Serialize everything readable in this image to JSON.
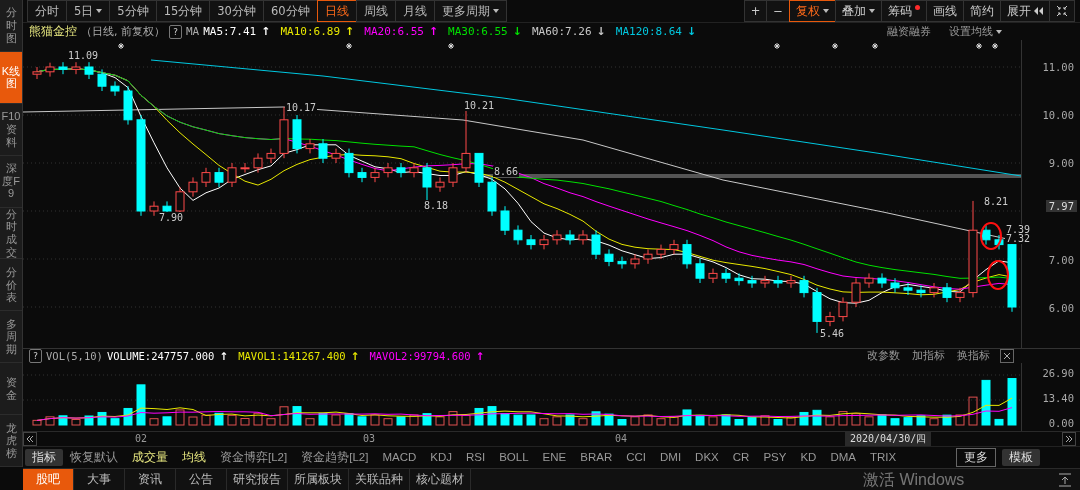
{
  "sidebar": {
    "items": [
      {
        "label": "分时图",
        "selected": false
      },
      {
        "label": "K线图",
        "selected": true
      },
      {
        "label": "F10资料",
        "selected": false
      },
      {
        "label": "深度F9",
        "selected": false
      },
      {
        "label": "分时成交",
        "selected": false
      },
      {
        "label": "分价表",
        "selected": false
      },
      {
        "label": "多周期",
        "selected": false
      },
      {
        "label": "资金",
        "selected": false
      },
      {
        "label": "龙虎榜",
        "selected": false
      }
    ]
  },
  "period_tabs": [
    {
      "label": "分时",
      "selected": false,
      "dropdown": false
    },
    {
      "label": "5日",
      "selected": false,
      "dropdown": true
    },
    {
      "label": "5分钟",
      "selected": false,
      "dropdown": false
    },
    {
      "label": "15分钟",
      "selected": false,
      "dropdown": false
    },
    {
      "label": "30分钟",
      "selected": false,
      "dropdown": false
    },
    {
      "label": "60分钟",
      "selected": false,
      "dropdown": false
    },
    {
      "label": "日线",
      "selected": true,
      "dropdown": false
    },
    {
      "label": "周线",
      "selected": false,
      "dropdown": false
    },
    {
      "label": "月线",
      "selected": false,
      "dropdown": false
    },
    {
      "label": "更多周期",
      "selected": false,
      "dropdown": true
    }
  ],
  "toolbar_buttons": [
    {
      "kind": "text",
      "label": "+",
      "selected": false
    },
    {
      "kind": "text",
      "label": "−",
      "selected": false
    },
    {
      "kind": "dropdown",
      "label": "复权",
      "selected": true
    },
    {
      "kind": "dropdown",
      "label": "叠加",
      "selected": false
    },
    {
      "kind": "dot",
      "label": "筹码",
      "selected": false
    },
    {
      "kind": "text",
      "label": "画线",
      "selected": false
    },
    {
      "kind": "text",
      "label": "简约",
      "selected": false
    },
    {
      "kind": "expand",
      "label": "展开",
      "selected": false
    },
    {
      "kind": "shrink",
      "selected": false
    }
  ],
  "legend": {
    "stock_name": "熊猫金控",
    "period": "（日线, 前复权）",
    "help": "?",
    "ma_label": "MA",
    "mas": [
      {
        "text": "MA5:7.41",
        "arrow": "↑",
        "color": "#ffffff"
      },
      {
        "text": "MA10:6.89",
        "arrow": "↑",
        "color": "#e8e800"
      },
      {
        "text": "MA20:6.55",
        "arrow": "↑",
        "color": "#ff00ff"
      },
      {
        "text": "MA30:6.55",
        "arrow": "↓",
        "color": "#00e000"
      },
      {
        "text": "MA60:7.26",
        "arrow": "↓",
        "color": "#c8c8c8"
      },
      {
        "text": "MA120:8.64",
        "arrow": "↓",
        "color": "#00c8e0"
      }
    ],
    "links": [
      {
        "label": "融资融券",
        "dropdown": false
      },
      {
        "label": "设置均线",
        "dropdown": true
      }
    ]
  },
  "price_axis": [
    {
      "label": "11.00",
      "highlighted": false
    },
    {
      "label": "10.00",
      "highlighted": false
    },
    {
      "label": "9.00",
      "highlighted": false
    },
    {
      "label": "7.97",
      "highlighted": true
    },
    {
      "label": "7.00",
      "highlighted": false
    },
    {
      "label": "6.00",
      "highlighted": false
    }
  ],
  "price_labels": [
    "11.09",
    "7.90",
    "10.17",
    "8.18",
    "10.21",
    "8.66",
    "5.46",
    "8.21",
    "7.39",
    "7.32"
  ],
  "volume": {
    "help": "?",
    "name": "VOL(5,10)",
    "items": [
      {
        "text": "VOLUME:247757.000",
        "arrow": "↑",
        "color": "#ffffff"
      },
      {
        "text": "MAVOL1:141267.400",
        "arrow": "↑",
        "color": "#e8e800"
      },
      {
        "text": "MAVOL2:99794.600",
        "arrow": "↑",
        "color": "#ff00ff"
      }
    ],
    "actions": [
      "改参数",
      "加指标",
      "换指标"
    ],
    "axis": [
      "26.90",
      "13.40",
      "0.00"
    ]
  },
  "date_axis": {
    "months": [
      "02",
      "03",
      "04"
    ],
    "cursor_date": "2020/04/30/四"
  },
  "indicator_tabs": [
    {
      "label": "指标",
      "kind": "filled",
      "active": false
    },
    {
      "label": "恢复默认",
      "kind": "tab",
      "active": false
    },
    {
      "label": "成交量",
      "kind": "tab",
      "active": true
    },
    {
      "label": "均线",
      "kind": "tab",
      "active": true
    },
    {
      "label": "资金博弈[L2]",
      "kind": "tab",
      "active": false
    },
    {
      "label": "资金趋势[L2]",
      "kind": "tab",
      "active": false
    },
    {
      "label": "MACD",
      "kind": "tab",
      "active": false
    },
    {
      "label": "KDJ",
      "kind": "tab",
      "active": false
    },
    {
      "label": "RSI",
      "kind": "tab",
      "active": false
    },
    {
      "label": "BOLL",
      "kind": "tab",
      "active": false
    },
    {
      "label": "ENE",
      "kind": "tab",
      "active": false
    },
    {
      "label": "BRAR",
      "kind": "tab",
      "active": false
    },
    {
      "label": "CCI",
      "kind": "tab",
      "active": false
    },
    {
      "label": "DMI",
      "kind": "tab",
      "active": false
    },
    {
      "label": "DKX",
      "kind": "tab",
      "active": false
    },
    {
      "label": "CR",
      "kind": "tab",
      "active": false
    },
    {
      "label": "PSY",
      "kind": "tab",
      "active": false
    },
    {
      "label": "KD",
      "kind": "tab",
      "active": false
    },
    {
      "label": "DMA",
      "kind": "tab",
      "active": false
    },
    {
      "label": "TRIX",
      "kind": "tab",
      "active": false
    },
    {
      "label": "更多",
      "kind": "boxed",
      "active": false
    },
    {
      "label": "模板",
      "kind": "filled",
      "active": false
    }
  ],
  "bottom_tabs": [
    {
      "label": "股吧",
      "selected": true
    },
    {
      "label": "大事",
      "selected": false
    },
    {
      "label": "资讯",
      "selected": false
    },
    {
      "label": "公告",
      "selected": false
    },
    {
      "label": "研究报告",
      "selected": false
    },
    {
      "label": "所属板块",
      "selected": false
    },
    {
      "label": "关联品种",
      "selected": false
    },
    {
      "label": "核心题材",
      "selected": false
    }
  ],
  "windows_notice": "激活 Windows"
}
